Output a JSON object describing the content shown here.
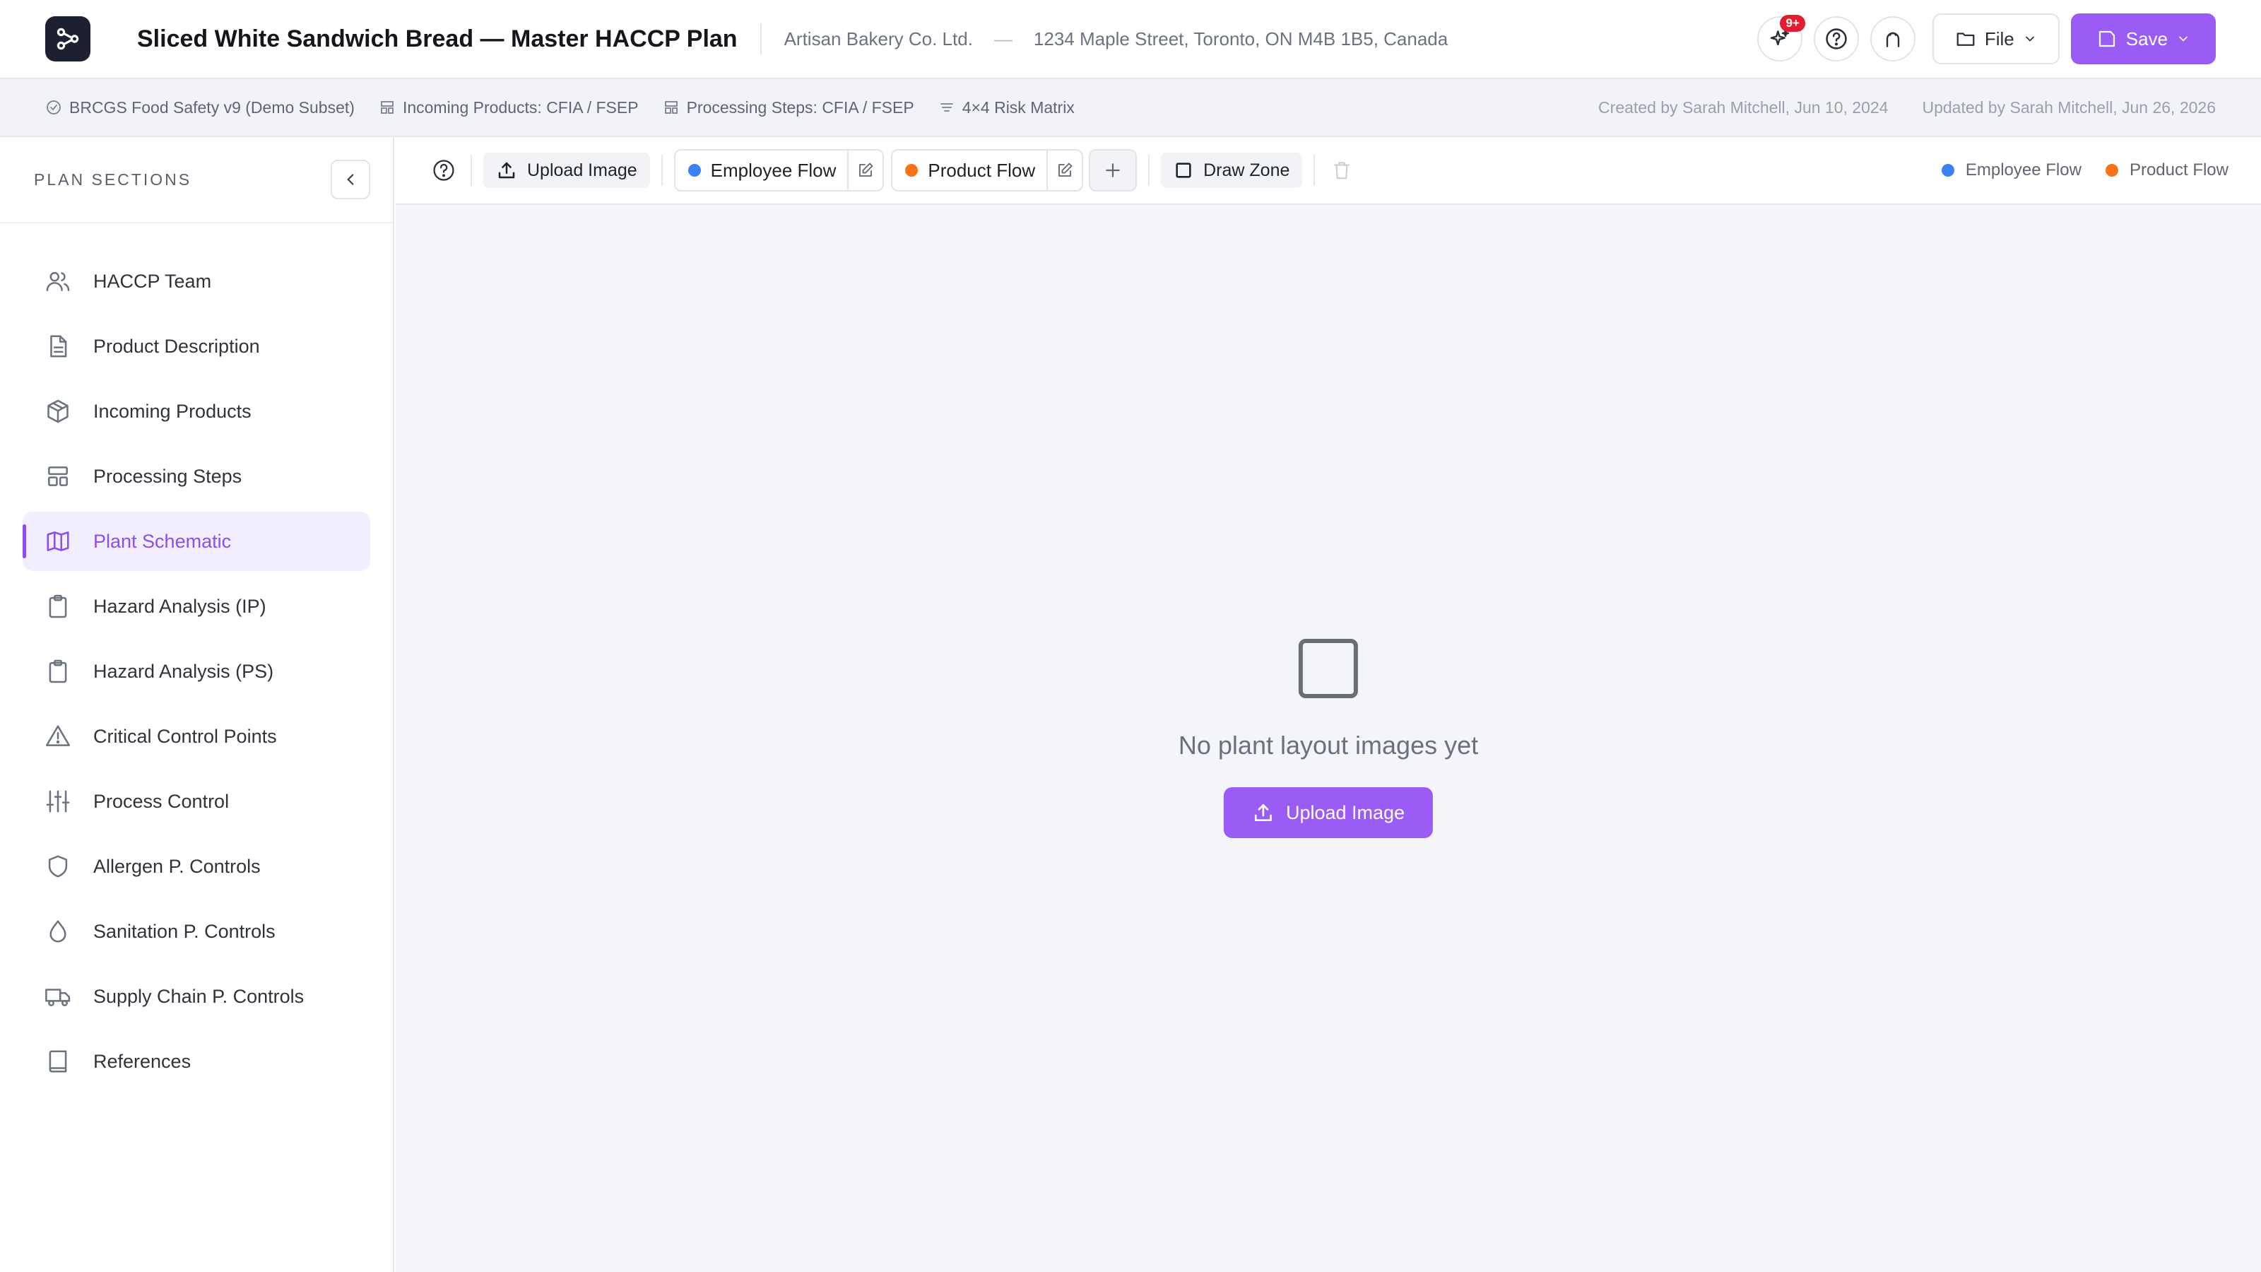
{
  "header": {
    "title": "Sliced White Sandwich Bread — Master HACCP Plan",
    "company": "Artisan Bakery Co. Ltd.",
    "separator": "—",
    "address": "1234 Maple Street, Toronto, ON M4B 1B5, Canada",
    "notification_badge": "9+",
    "file_label": "File",
    "save_label": "Save"
  },
  "subheader": {
    "standard": "BRCGS Food Safety v9 (Demo Subset)",
    "incoming_products": "Incoming Products: CFIA / FSEP",
    "processing_steps": "Processing Steps: CFIA / FSEP",
    "risk_matrix": "4×4 Risk Matrix",
    "created": "Created by Sarah Mitchell, Jun 10, 2024",
    "updated": "Updated by Sarah Mitchell, Jun 26, 2026"
  },
  "sidebar": {
    "title": "PLAN SECTIONS",
    "items": [
      {
        "label": "HACCP Team",
        "icon": "users-icon"
      },
      {
        "label": "Product Description",
        "icon": "document-icon"
      },
      {
        "label": "Incoming Products",
        "icon": "box-icon"
      },
      {
        "label": "Processing Steps",
        "icon": "layout-icon"
      },
      {
        "label": "Plant Schematic",
        "icon": "map-icon",
        "active": true
      },
      {
        "label": "Hazard Analysis (IP)",
        "icon": "clipboard-icon"
      },
      {
        "label": "Hazard Analysis (PS)",
        "icon": "clipboard-icon"
      },
      {
        "label": "Critical Control Points",
        "icon": "warning-icon"
      },
      {
        "label": "Process Control",
        "icon": "sliders-icon"
      },
      {
        "label": "Allergen P. Controls",
        "icon": "shield-icon"
      },
      {
        "label": "Sanitation P. Controls",
        "icon": "droplet-icon"
      },
      {
        "label": "Supply Chain P. Controls",
        "icon": "truck-icon"
      },
      {
        "label": "References",
        "icon": "book-icon"
      }
    ]
  },
  "toolbar": {
    "upload_label": "Upload Image",
    "employee_flow": "Employee Flow",
    "product_flow": "Product Flow",
    "draw_zone": "Draw Zone",
    "legend_employee": "Employee Flow",
    "legend_product": "Product Flow"
  },
  "canvas": {
    "empty_text": "No plant layout images yet",
    "upload_label": "Upload Image"
  },
  "colors": {
    "accent": "#9b5cf6",
    "employee_flow": "#3b82f6",
    "product_flow": "#f97316",
    "badge": "#e11d2e"
  }
}
